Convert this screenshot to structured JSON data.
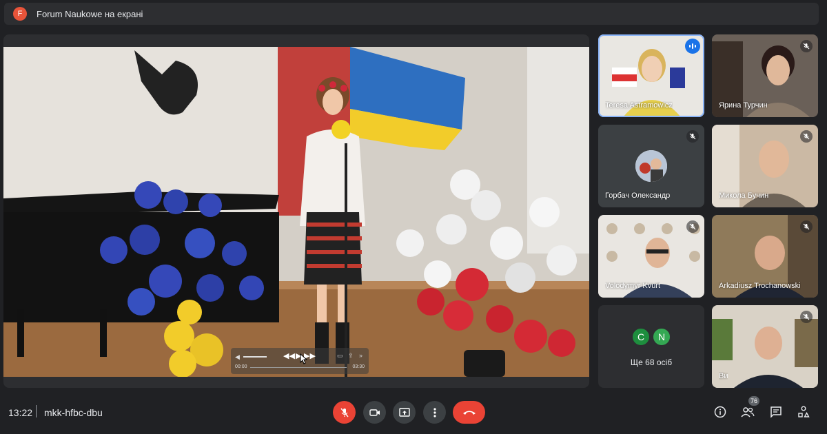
{
  "window": {
    "presenter_initial": "F",
    "title": "Forum Naukowe на екрані"
  },
  "player": {
    "time_current": "00:00",
    "time_total": "03:30"
  },
  "participants": [
    {
      "name": "Teresa Astramowicz",
      "speaking": true,
      "muted": false
    },
    {
      "name": "Ярина Турчин",
      "speaking": false,
      "muted": true
    },
    {
      "name": "Горбач Олександр",
      "speaking": false,
      "muted": true
    },
    {
      "name": "Микола Бучин",
      "speaking": false,
      "muted": true
    },
    {
      "name": "Volodymyr Kvurt",
      "speaking": false,
      "muted": true
    },
    {
      "name": "Arkadiusz Trochanowski",
      "speaking": false,
      "muted": true
    },
    {
      "name": "Ви",
      "speaking": false,
      "muted": true
    }
  ],
  "others_tile": {
    "chips": [
      "C",
      "N"
    ],
    "label": "Ще 68 осіб"
  },
  "bottombar": {
    "time": "13:22",
    "meeting_code": "mkk-hfbc-dbu",
    "participant_count": "76"
  },
  "colors": {
    "background": "#202124",
    "tile": "#3c4043",
    "accent_blue": "#1a73e8",
    "danger_red": "#ea4335"
  }
}
